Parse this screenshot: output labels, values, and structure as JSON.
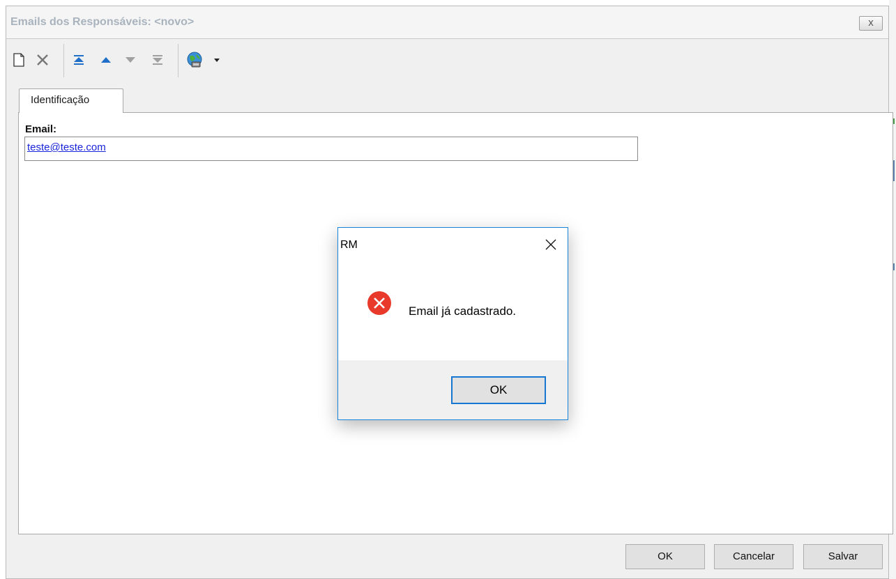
{
  "window": {
    "title": "Emails dos Responsáveis: <novo>",
    "close_label": "x"
  },
  "toolbar": {
    "items": [
      {
        "icon": "new-document-icon"
      },
      {
        "icon": "delete-icon"
      },
      {
        "icon": "first-record-icon"
      },
      {
        "icon": "previous-record-icon"
      },
      {
        "icon": "next-record-icon"
      },
      {
        "icon": "last-record-icon"
      },
      {
        "icon": "globe-link-icon"
      },
      {
        "icon": "dropdown-arrow-icon"
      }
    ]
  },
  "tabs": [
    {
      "label": "Identificação",
      "active": true
    }
  ],
  "form": {
    "email_label": "Email:",
    "email_value": "teste@teste.com"
  },
  "buttons": {
    "ok": "OK",
    "cancel": "Cancelar",
    "save": "Salvar"
  },
  "dialog": {
    "title": "RM",
    "message": "Email já cadastrado.",
    "ok": "OK",
    "icon": "error-icon",
    "colors": {
      "error": "#e8392b",
      "border": "#1883d7"
    }
  }
}
